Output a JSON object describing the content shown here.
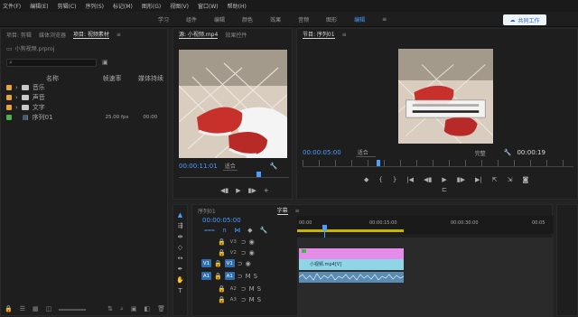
{
  "menu": [
    "文件(F)",
    "编辑(E)",
    "剪辑(C)",
    "序列(S)",
    "标记(M)",
    "图形(G)",
    "视图(V)",
    "窗口(W)",
    "帮助(H)"
  ],
  "workspace": {
    "tabs": [
      "学习",
      "组件",
      "编辑",
      "颜色",
      "效果",
      "音频",
      "图形",
      "库"
    ],
    "active": "编辑",
    "share_label": "共同工作"
  },
  "project": {
    "tabs": [
      "项目: 剪辑",
      "媒体浏览器",
      "项目: 视频素材"
    ],
    "active_index": 2,
    "title": "小狗视频.prproj",
    "columns": [
      "名称",
      "帧速率",
      "媒体持续"
    ],
    "items": [
      {
        "name": "音乐",
        "color": "#e8a33d",
        "type": "folder"
      },
      {
        "name": "声音",
        "color": "#e8a33d",
        "type": "folder"
      },
      {
        "name": "文字",
        "color": "#e8a33d",
        "type": "folder"
      },
      {
        "name": "序列01",
        "color": "#4caf50",
        "type": "sequence",
        "fps": "25.00 fps",
        "duration": "00:00"
      }
    ]
  },
  "source": {
    "tabs": [
      "源: 小视频.mp4",
      "效果控件"
    ],
    "timecode": "00:00:11:01",
    "fit": "适合",
    "icons": [
      "mark-in-icon",
      "mark-out-icon",
      "play-icon",
      "camera-icon",
      "add-icon"
    ]
  },
  "program": {
    "title": "节目: 序列01",
    "timecode": "00:00:05:00",
    "fit": "适合",
    "quality": "完整",
    "end_timecode": "00:00:19"
  },
  "timeline": {
    "tabs": [
      "序列01",
      "字幕"
    ],
    "timecode": "00:00:05:00",
    "ruler": [
      "00:00",
      "00:00:15:00",
      "00:00:30:00",
      "00:05"
    ],
    "video_tracks": [
      "V3",
      "V2",
      "V1"
    ],
    "audio_tracks": [
      "A1",
      "A2",
      "A3"
    ],
    "clip_name": "小视频.mp4[V]"
  },
  "colors": {
    "accent": "#4d9cff",
    "clip_pink": "#e58be8",
    "clip_cyan": "#8fd5e8",
    "audio": "#5a8bb0"
  }
}
